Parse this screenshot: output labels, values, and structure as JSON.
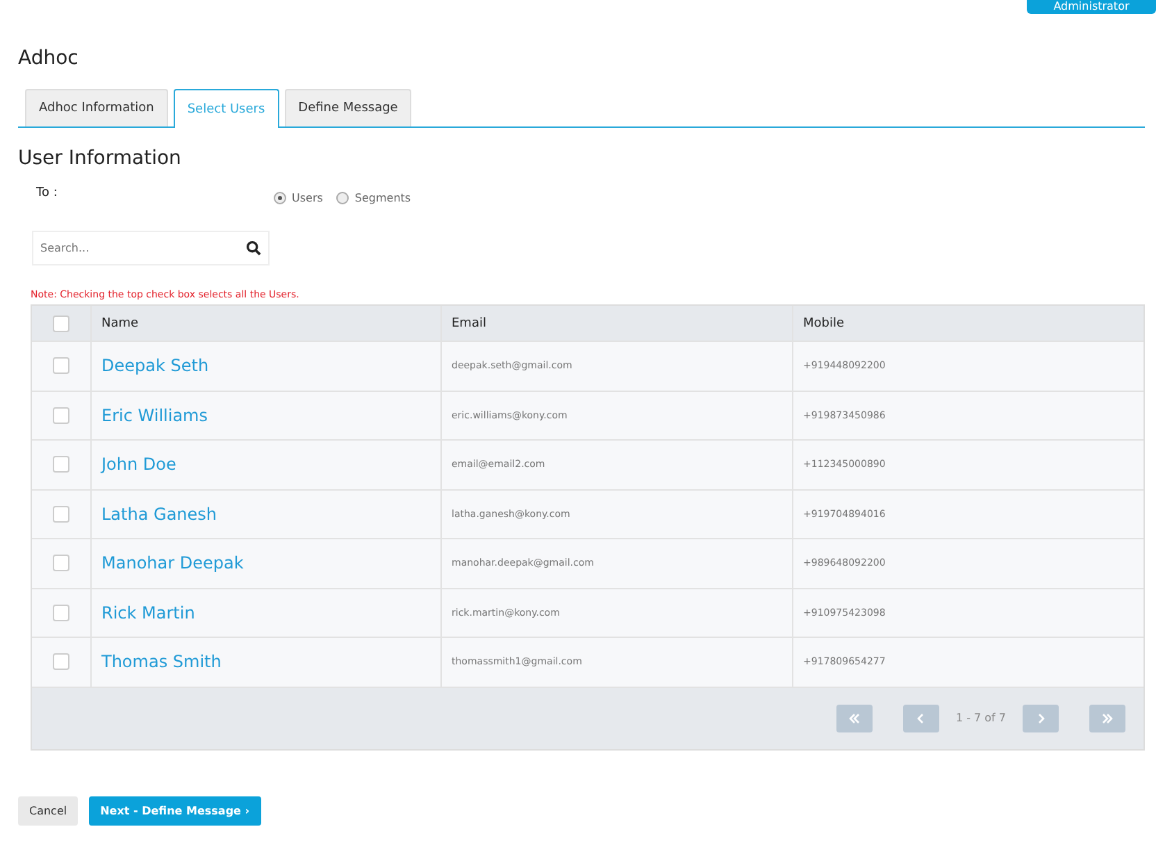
{
  "header": {
    "user_button": "Administrator"
  },
  "page_title": "Adhoc",
  "tabs": [
    {
      "label": "Adhoc Information",
      "selected": false
    },
    {
      "label": "Select Users",
      "selected": true
    },
    {
      "label": "Define Message",
      "selected": false
    }
  ],
  "section_title": "User Information",
  "recipient": {
    "label": "To :",
    "options": [
      {
        "label": "Users",
        "selected": true
      },
      {
        "label": "Segments",
        "selected": false
      }
    ]
  },
  "search": {
    "placeholder": "Search..."
  },
  "note": "Note: Checking the top check box selects all the Users.",
  "table": {
    "select_all_checked": false,
    "columns": [
      "Name",
      "Email",
      "Mobile"
    ],
    "rows": [
      {
        "checked": false,
        "name": "Deepak Seth",
        "email": "deepak.seth@gmail.com",
        "mobile": "+919448092200"
      },
      {
        "checked": false,
        "name": "Eric Williams",
        "email": "eric.williams@kony.com",
        "mobile": "+919873450986"
      },
      {
        "checked": false,
        "name": "John Doe",
        "email": "email@email2.com",
        "mobile": "+112345000890"
      },
      {
        "checked": false,
        "name": "Latha Ganesh",
        "email": "latha.ganesh@kony.com",
        "mobile": "+919704894016"
      },
      {
        "checked": false,
        "name": "Manohar Deepak",
        "email": "manohar.deepak@gmail.com",
        "mobile": "+989648092200"
      },
      {
        "checked": false,
        "name": "Rick Martin",
        "email": "rick.martin@kony.com",
        "mobile": "+910975423098"
      },
      {
        "checked": false,
        "name": "Thomas Smith",
        "email": "thomassmith1@gmail.com",
        "mobile": "+917809654277"
      }
    ],
    "pagination": {
      "range": "1 - 7 of 7"
    }
  },
  "buttons": {
    "cancel": "Cancel",
    "next": "Next - Define Message ›"
  }
}
